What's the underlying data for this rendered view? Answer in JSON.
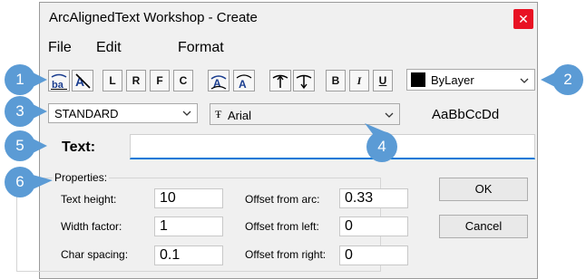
{
  "dialog": {
    "title": "ArcAlignedText Workshop - Create",
    "close_glyph": "✕"
  },
  "menu": [
    "File",
    "Edit",
    "Format"
  ],
  "toolbar": {
    "text_buttons": {
      "left": "L",
      "right": "R",
      "fit": "F",
      "center": "C",
      "bold": "B",
      "italic": "I",
      "underline": "U"
    },
    "icons": [
      "reverse-text-icon",
      "convex-side-icon",
      "concave-side-icon",
      "outward-direction-icon",
      "inward-direction-icon"
    ]
  },
  "color_combo": {
    "value": "ByLayer",
    "swatch": "#000000"
  },
  "style_combo": {
    "value": "STANDARD"
  },
  "font_combo": {
    "value": "Arial",
    "font_icon_glyph": "Ŧ"
  },
  "preview": "AaBbCcDd",
  "text_field": {
    "label": "Text:",
    "value": ""
  },
  "properties": {
    "title": "Properties:",
    "text_height_label": "Text height:",
    "text_height": "10",
    "width_factor_label": "Width factor:",
    "width_factor": "1",
    "char_spacing_label": "Char spacing:",
    "char_spacing": "0.1",
    "offset_arc_label": "Offset from arc:",
    "offset_arc": "0.33",
    "offset_left_label": "Offset from left:",
    "offset_left": "0",
    "offset_right_label": "Offset from right:",
    "offset_right": "0"
  },
  "buttons": {
    "ok": "OK",
    "cancel": "Cancel"
  },
  "callouts": [
    "1",
    "2",
    "3",
    "4",
    "5",
    "6"
  ],
  "colors": {
    "callout": "#5b9bd5",
    "close": "#e81123",
    "focus_underline": "#0078d7"
  }
}
